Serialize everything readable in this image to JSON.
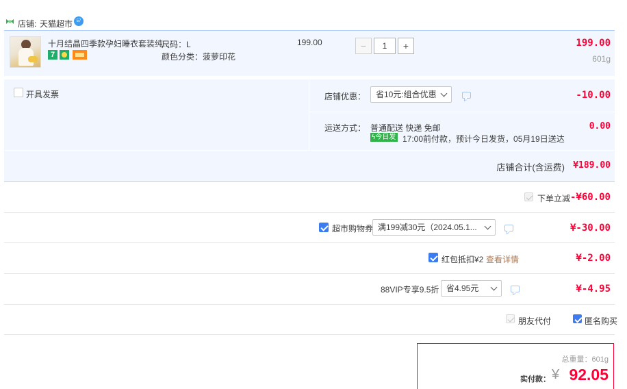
{
  "shop": {
    "label": "店铺:",
    "name": "天猫超市",
    "badge": "57"
  },
  "item": {
    "title": "十月结晶四季款孕妇睡衣套装纯...",
    "sku_size": "尺码：L",
    "sku_color": "颜色分类：菠萝印花",
    "unit_price": "199.00",
    "quantity": "1",
    "subtotal": "199.00",
    "weight": "601g",
    "tag1": "7",
    "minus": "−",
    "plus": "+"
  },
  "invoice": {
    "label": "开具发票"
  },
  "shop_discount": {
    "label": "店铺优惠：",
    "select": "省10元:组合优惠",
    "amount": "-10.00"
  },
  "shipping": {
    "label": "运送方式：",
    "method": "普通配送 快递 免邮",
    "badge": "今日发",
    "detail": "17:00前付款，预计今日发货，05月19日送达",
    "amount": "0.00"
  },
  "shop_total": {
    "label": "店铺合计(含运费)",
    "amount": "¥189.00"
  },
  "instant_discount": {
    "label": "下单立减",
    "amount": "-¥60.00"
  },
  "coupon": {
    "label": "超市购物券",
    "select": "满199减30元（2024.05.1...",
    "amount": "¥-30.00"
  },
  "redpacket": {
    "label": "红包抵扣¥2",
    "link": "查看详情",
    "amount": "¥-2.00"
  },
  "vip": {
    "label": "88VIP专享9.5折",
    "select": "省4.95元",
    "amount": "¥-4.95"
  },
  "options": {
    "friend_pay": "朋友代付",
    "anonymous": "匿名购买"
  },
  "summary": {
    "weight_label": "总重量：",
    "weight": "601g",
    "pay_label": "实付款：",
    "currency": "¥",
    "total": "92.05"
  },
  "colors": {
    "accent_red": "#ff0036",
    "header_blue": "#b2d1ff",
    "panel_bg": "#f2f7ff",
    "check_blue": "#3d7cf0",
    "green": "#2fb34a"
  }
}
